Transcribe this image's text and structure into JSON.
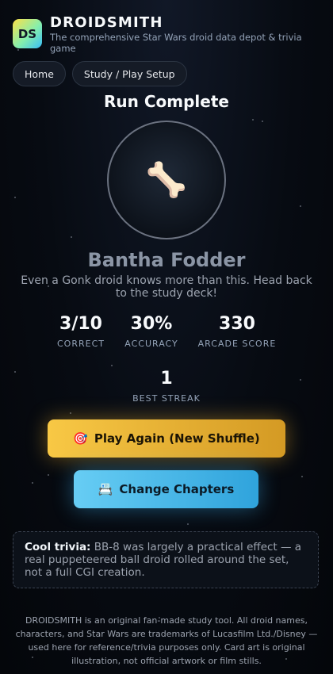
{
  "brand": {
    "logo_text": "DS",
    "title": "DROIDSMITH",
    "subtitle": "The comprehensive Star Wars droid data depot & trivia game"
  },
  "nav": {
    "home": "Home",
    "setup": "Study / Play Setup"
  },
  "result": {
    "heading": "Run Complete",
    "badge_icon": "bone-icon",
    "badge_glyph": "🦴",
    "rank": "Bantha Fodder",
    "message": "Even a Gonk droid knows more than this. Head back to the study deck!"
  },
  "stats": {
    "correct": {
      "value": "3/10",
      "label": "CORRECT"
    },
    "accuracy": {
      "value": "30%",
      "label": "ACCURACY"
    },
    "score": {
      "value": "330",
      "label": "ARCADE SCORE"
    },
    "streak": {
      "value": "1",
      "label": "BEST STREAK"
    }
  },
  "actions": {
    "play_again_icon": "🎯",
    "play_again": "Play Again (New Shuffle)",
    "change_chapters_icon": "📇",
    "change_chapters": "Change Chapters"
  },
  "trivia": {
    "label": "Cool trivia:",
    "text": "BB-8 was largely a practical effect — a real puppeteered ball droid rolled around the set, not a full CGI creation."
  },
  "footer": "DROIDSMITH is an original fan-made study tool. All droid names, characters, and Star Wars are trademarks of Lucasfilm Ltd./Disney — used here for reference/trivia purposes only. Card art is original illustration, not official artwork or film stills.",
  "colors": {
    "play_accent": "#f8c845",
    "chapters_accent": "#38bdf8",
    "rank_text": "#8b95a5"
  }
}
